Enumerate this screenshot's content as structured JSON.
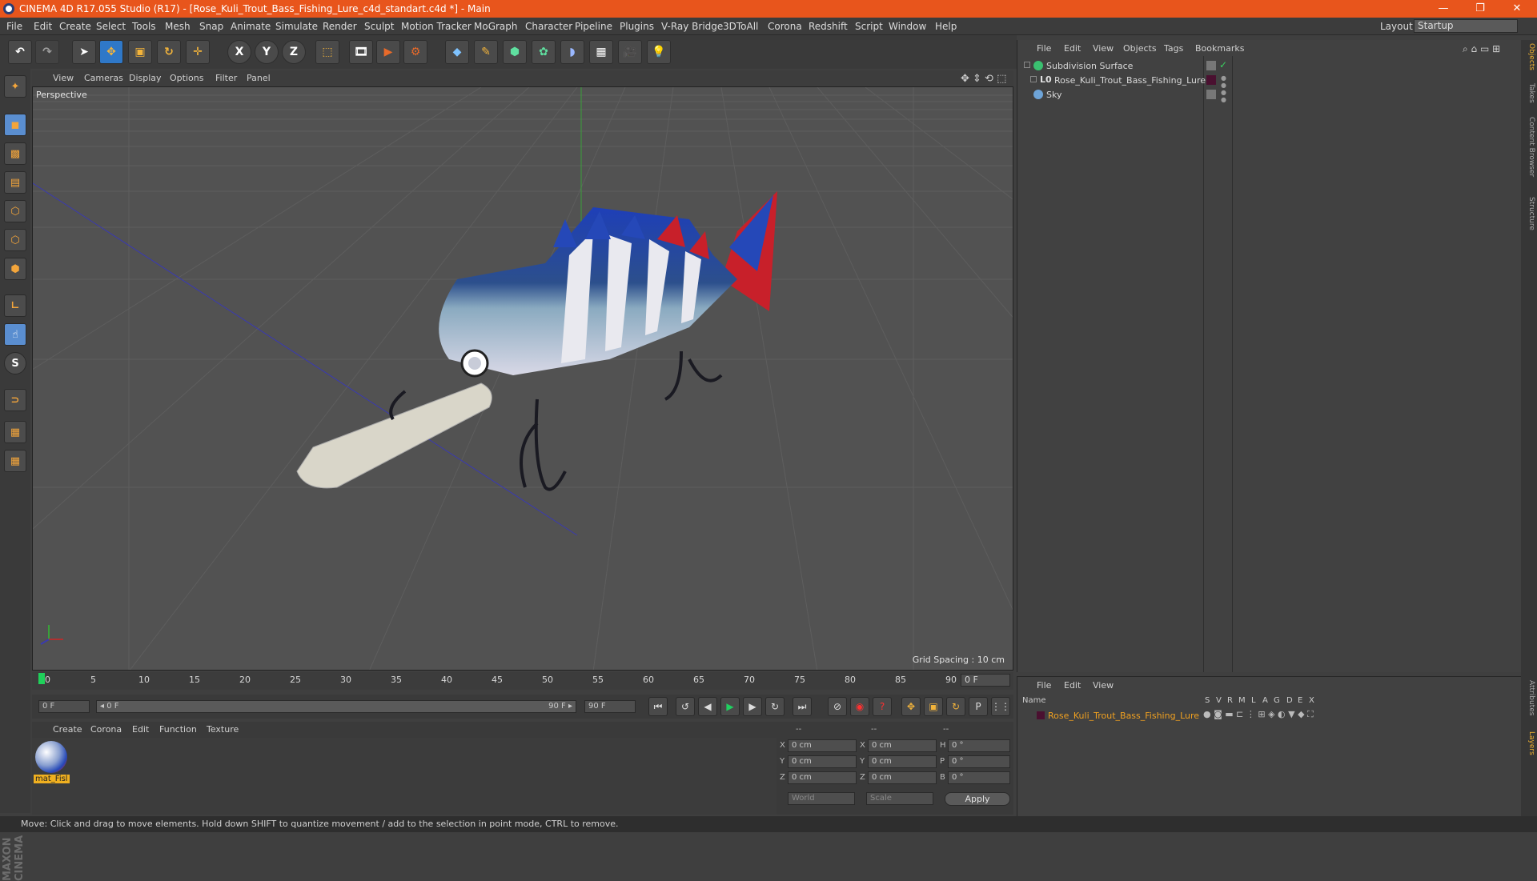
{
  "window": {
    "title": "CINEMA 4D R17.055 Studio (R17) - [Rose_Kuli_Trout_Bass_Fishing_Lure_c4d_standart.c4d *] - Main",
    "min": "—",
    "max": "❐",
    "close": "✕"
  },
  "menu": [
    "File",
    "Edit",
    "Create",
    "Select",
    "Tools",
    "Mesh",
    "Snap",
    "Animate",
    "Simulate",
    "Render",
    "Sculpt",
    "Motion Tracker",
    "MoGraph",
    "Character",
    "Pipeline",
    "Plugins",
    "V-Ray Bridge",
    "3DToAll",
    "Corona",
    "Redshift",
    "Script",
    "Window",
    "Help"
  ],
  "layout": {
    "label": "Layout:",
    "value": "Startup"
  },
  "toolbar": {
    "x": "X",
    "y": "Y",
    "z": "Z"
  },
  "viewport": {
    "menu": [
      "View",
      "Cameras",
      "Display",
      "Options",
      "Filter",
      "Panel"
    ],
    "label": "Perspective",
    "grid_spacing": "Grid Spacing : 10 cm"
  },
  "timeline": {
    "ticks": [
      "0",
      "5",
      "10",
      "15",
      "20",
      "25",
      "30",
      "35",
      "40",
      "45",
      "50",
      "55",
      "60",
      "65",
      "70",
      "75",
      "80",
      "85",
      "90"
    ],
    "frame_display": "0 F",
    "start_field": "0 F",
    "range_start": "◂ 0 F",
    "range_end": "90 F ▸",
    "end_field": "90 F"
  },
  "material_manager": {
    "menu": [
      "Create",
      "Corona",
      "Edit",
      "Function",
      "Texture"
    ],
    "material_name": "mat_Fisl"
  },
  "coords": {
    "headers": [
      "--",
      "--",
      "--"
    ],
    "rows": [
      {
        "a": "X",
        "av": "0 cm",
        "b": "X",
        "bv": "0 cm",
        "c": "H",
        "cv": "0 °"
      },
      {
        "a": "Y",
        "av": "0 cm",
        "b": "Y",
        "bv": "0 cm",
        "c": "P",
        "cv": "0 °"
      },
      {
        "a": "Z",
        "av": "0 cm",
        "b": "Z",
        "bv": "0 cm",
        "c": "B",
        "cv": "0 °"
      }
    ],
    "world": "World",
    "scale": "Scale",
    "apply": "Apply"
  },
  "object_manager": {
    "menu": [
      "File",
      "Edit",
      "View",
      "Objects",
      "Tags",
      "Bookmarks"
    ],
    "objects": [
      {
        "name": "Subdivision Surface"
      },
      {
        "name": "Rose_Kuli_Trout_Bass_Fishing_Lure"
      },
      {
        "name": "Sky"
      }
    ]
  },
  "layer_manager": {
    "menu": [
      "File",
      "Edit",
      "View"
    ],
    "columns": [
      "Name",
      "S",
      "V",
      "R",
      "M",
      "L",
      "A",
      "G",
      "D",
      "E",
      "X"
    ],
    "layer_name": "Rose_Kuli_Trout_Bass_Fishing_Lure"
  },
  "right_tabs": [
    "Objects",
    "Takes",
    "Content Browser",
    "Structure"
  ],
  "right_tabs_lower": [
    "Attributes",
    "Layers"
  ],
  "brand": "MAXON CINEMA 4D",
  "status": "Move: Click and drag to move elements. Hold down SHIFT to quantize movement / add to the selection in point mode, CTRL to remove.",
  "colors": {
    "titlebar": "#e8551c",
    "accent_blue": "#2f78c8",
    "layer_name": "#f0a020"
  }
}
